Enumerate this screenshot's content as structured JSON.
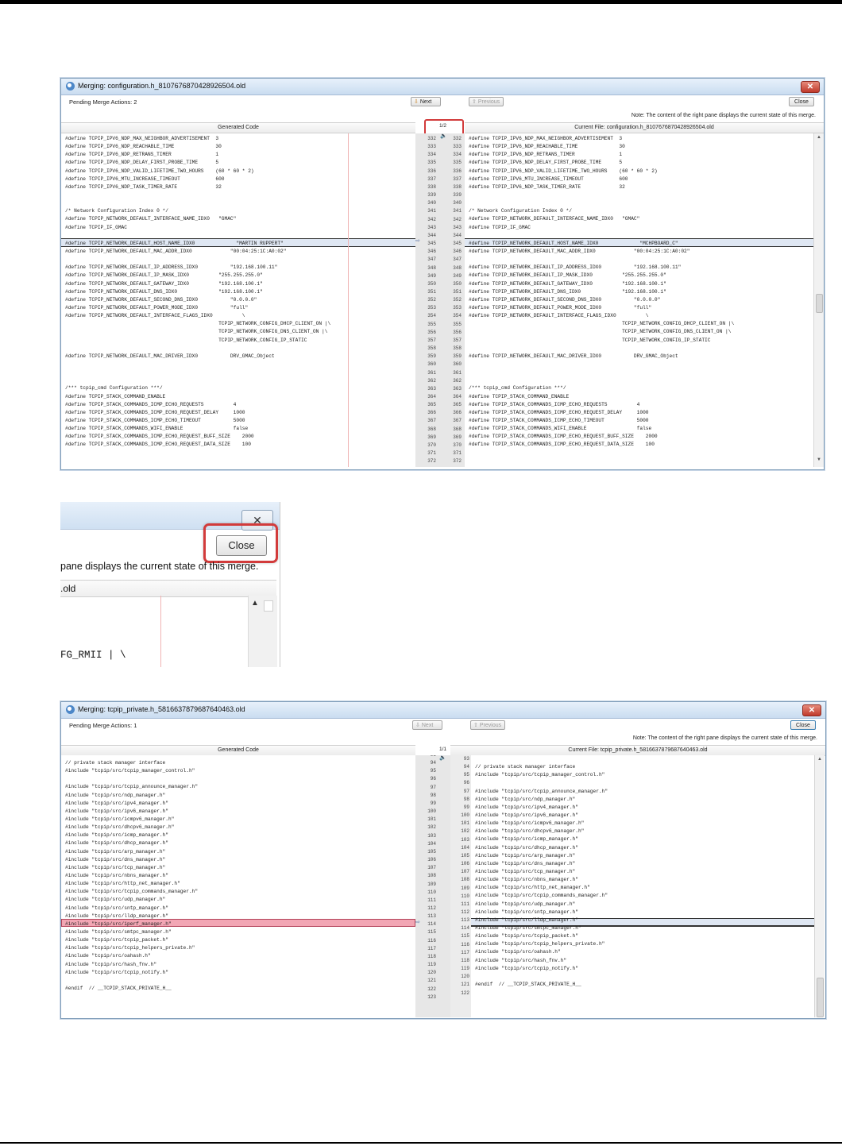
{
  "dialog1": {
    "title": "Merging: configuration.h_8107676870428926504.old",
    "pending_label": "Pending Merge Actions:  2",
    "next_label": "Next",
    "previous_label": "Previous",
    "close_label": "Close",
    "note": "Note:  The content of the right pane displays the current state of this merge.",
    "left_header": "Generated Code",
    "right_header": "Current File: configuration.h_8107676870428926504.old",
    "counter": "1/2",
    "left_lines": [
      "#define TCPIP_IPV6_NDP_MAX_NEIGHBOR_ADVERTISEMENT  3",
      "#define TCPIP_IPV6_NDP_REACHABLE_TIME              30",
      "#define TCPIP_IPV6_NDP_RETRANS_TIMER               1",
      "#define TCPIP_IPV6_NDP_DELAY_FIRST_PROBE_TIME      5",
      "#define TCPIP_IPV6_NDP_VALID_LIFETIME_TWO_HOURS    (60 * 60 * 2)",
      "#define TCPIP_IPV6_MTU_INCREASE_TIMEOUT            600",
      "#define TCPIP_IPV6_NDP_TASK_TIMER_RATE             32",
      "",
      "",
      "/* Network Configuration Index 0 */",
      "#define TCPIP_NETWORK_DEFAULT_INTERFACE_NAME_IDX0   \"GMAC\"",
      "#define TCPIP_IF_GMAC",
      "",
      "#define TCPIP_NETWORK_DEFAULT_HOST_NAME_IDX0              \"MARTIN RUPPERT\"",
      "#define TCPIP_NETWORK_DEFAULT_MAC_ADDR_IDX0             \"00:04:25:1C:A0:02\"",
      "",
      "#define TCPIP_NETWORK_DEFAULT_IP_ADDRESS_IDX0           \"192.168.100.11\"",
      "#define TCPIP_NETWORK_DEFAULT_IP_MASK_IDX0          \"255.255.255.0\"",
      "#define TCPIP_NETWORK_DEFAULT_GATEWAY_IDX0          \"192.168.100.1\"",
      "#define TCPIP_NETWORK_DEFAULT_DNS_IDX0              \"192.168.100.1\"",
      "#define TCPIP_NETWORK_DEFAULT_SECOND_DNS_IDX0           \"0.0.0.0\"",
      "#define TCPIP_NETWORK_DEFAULT_POWER_MODE_IDX0           \"full\"",
      "#define TCPIP_NETWORK_DEFAULT_INTERFACE_FLAGS_IDX0          \\",
      "                                                    TCPIP_NETWORK_CONFIG_DHCP_CLIENT_ON |\\",
      "                                                    TCPIP_NETWORK_CONFIG_DNS_CLIENT_ON |\\",
      "                                                    TCPIP_NETWORK_CONFIG_IP_STATIC",
      "",
      "#define TCPIP_NETWORK_DEFAULT_MAC_DRIVER_IDX0           DRV_GMAC_Object",
      "",
      "",
      "",
      "/*** tcpip_cmd Configuration ***/",
      "#define TCPIP_STACK_COMMAND_ENABLE",
      "#define TCPIP_STACK_COMMANDS_ICMP_ECHO_REQUESTS          4",
      "#define TCPIP_STACK_COMMANDS_ICMP_ECHO_REQUEST_DELAY     1000",
      "#define TCPIP_STACK_COMMANDS_ICMP_ECHO_TIMEOUT           5000",
      "#define TCPIP_STACK_COMMANDS_WIFI_ENABLE                 false",
      "#define TCPIP_STACK_COMMANDS_ICMP_ECHO_REQUEST_BUFF_SIZE    2000",
      "#define TCPIP_STACK_COMMANDS_ICMP_ECHO_REQUEST_DATA_SIZE    100"
    ],
    "right_lines": [
      "#define TCPIP_IPV6_NDP_MAX_NEIGHBOR_ADVERTISEMENT  3",
      "#define TCPIP_IPV6_NDP_REACHABLE_TIME              30",
      "#define TCPIP_IPV6_NDP_RETRANS_TIMER               1",
      "#define TCPIP_IPV6_NDP_DELAY_FIRST_PROBE_TIME      5",
      "#define TCPIP_IPV6_NDP_VALID_LIFETIME_TWO_HOURS    (60 * 60 * 2)",
      "#define TCPIP_IPV6_MTU_INCREASE_TIMEOUT            600",
      "#define TCPIP_IPV6_NDP_TASK_TIMER_RATE             32",
      "",
      "",
      "/* Network Configuration Index 0 */",
      "#define TCPIP_NETWORK_DEFAULT_INTERFACE_NAME_IDX0   \"GMAC\"",
      "#define TCPIP_IF_GMAC",
      "",
      "#define TCPIP_NETWORK_DEFAULT_HOST_NAME_IDX0              \"MCHPBOARD_C\"",
      "#define TCPIP_NETWORK_DEFAULT_MAC_ADDR_IDX0             \"00:04:25:1C:A0:02\"",
      "",
      "#define TCPIP_NETWORK_DEFAULT_IP_ADDRESS_IDX0           \"192.168.100.11\"",
      "#define TCPIP_NETWORK_DEFAULT_IP_MASK_IDX0          \"255.255.255.0\"",
      "#define TCPIP_NETWORK_DEFAULT_GATEWAY_IDX0          \"192.168.100.1\"",
      "#define TCPIP_NETWORK_DEFAULT_DNS_IDX0              \"192.168.100.1\"",
      "#define TCPIP_NETWORK_DEFAULT_SECOND_DNS_IDX0           \"0.0.0.0\"",
      "#define TCPIP_NETWORK_DEFAULT_POWER_MODE_IDX0           \"full\"",
      "#define TCPIP_NETWORK_DEFAULT_INTERFACE_FLAGS_IDX0          \\",
      "                                                    TCPIP_NETWORK_CONFIG_DHCP_CLIENT_ON |\\",
      "                                                    TCPIP_NETWORK_CONFIG_DNS_CLIENT_ON |\\",
      "                                                    TCPIP_NETWORK_CONFIG_IP_STATIC",
      "",
      "#define TCPIP_NETWORK_DEFAULT_MAC_DRIVER_IDX0           DRV_GMAC_Object",
      "",
      "",
      "",
      "/*** tcpip_cmd Configuration ***/",
      "#define TCPIP_STACK_COMMAND_ENABLE",
      "#define TCPIP_STACK_COMMANDS_ICMP_ECHO_REQUESTS          4",
      "#define TCPIP_STACK_COMMANDS_ICMP_ECHO_REQUEST_DELAY     1000",
      "#define TCPIP_STACK_COMMANDS_ICMP_ECHO_TIMEOUT           5000",
      "#define TCPIP_STACK_COMMANDS_WIFI_ENABLE                 false",
      "#define TCPIP_STACK_COMMANDS_ICMP_ECHO_REQUEST_BUFF_SIZE    2000",
      "#define TCPIP_STACK_COMMANDS_ICMP_ECHO_REQUEST_DATA_SIZE    100"
    ],
    "left_numbers": "332\n333\n334\n335\n336\n337\n338\n339\n340\n341\n342\n343\n344\n345\n346\n347\n348\n349\n350\n351\n352\n353\n354\n355\n356\n357\n358\n359\n360\n361\n362\n363\n364\n365\n366\n367\n368\n369\n370\n371\n372",
    "right_numbers": "332\n333\n334\n335\n336\n337\n338\n339\n340\n341\n342\n343\n344\n345\n346\n347\n348\n349\n350\n351\n352\n353\n354\n355\n356\n357\n358\n359\n360\n361\n362\n363\n364\n365\n366\n367\n368\n369\n370\n371\n372"
  },
  "zoom": {
    "close_label": "Close",
    "note": "pane displays the current state of this merge.",
    "header": ".old",
    "code": "FG_RMII | \\"
  },
  "dialog2": {
    "title": "Merging: tcpip_private.h_5816637879687640463.old",
    "pending_label": "Pending Merge Actions:  1",
    "next_label": "Next",
    "previous_label": "Previous",
    "close_label": "Close",
    "note": "Note:  The content of the right pane displays the current state of this merge.",
    "left_header": "Generated Code",
    "right_header": "Current File: tcpip_private.h_5816637879687640463.old",
    "counter": "1/1",
    "left_lines": [
      "// private stack manager interface",
      "#include \"tcpip/src/tcpip_manager_control.h\"",
      "",
      "#include \"tcpip/src/tcpip_announce_manager.h\"",
      "#include \"tcpip/src/ndp_manager.h\"",
      "#include \"tcpip/src/ipv4_manager.h\"",
      "#include \"tcpip/src/ipv6_manager.h\"",
      "#include \"tcpip/src/icmpv6_manager.h\"",
      "#include \"tcpip/src/dhcpv6_manager.h\"",
      "#include \"tcpip/src/icmp_manager.h\"",
      "#include \"tcpip/src/dhcp_manager.h\"",
      "#include \"tcpip/src/arp_manager.h\"",
      "#include \"tcpip/src/dns_manager.h\"",
      "#include \"tcpip/src/tcp_manager.h\"",
      "#include \"tcpip/src/nbns_manager.h\"",
      "#include \"tcpip/src/http_net_manager.h\"",
      "#include \"tcpip/src/tcpip_commands_manager.h\"",
      "#include \"tcpip/src/udp_manager.h\"",
      "#include \"tcpip/src/sntp_manager.h\"",
      "#include \"tcpip/src/lldp_manager.h\"",
      "#include \"tcpip/src/iperf_manager.h\"",
      "#include \"tcpip/src/smtpc_manager.h\"",
      "#include \"tcpip/src/tcpip_packet.h\"",
      "#include \"tcpip/src/tcpip_helpers_private.h\"",
      "#include \"tcpip/src/oahash.h\"",
      "#include \"tcpip/src/hash_fnv.h\"",
      "#include \"tcpip/src/tcpip_notify.h\"",
      "",
      "#endif  // __TCPIP_STACK_PRIVATE_H__"
    ],
    "right_lines": [
      "",
      "// private stack manager interface",
      "#include \"tcpip/src/tcpip_manager_control.h\"",
      "",
      "#include \"tcpip/src/tcpip_announce_manager.h\"",
      "#include \"tcpip/src/ndp_manager.h\"",
      "#include \"tcpip/src/ipv4_manager.h\"",
      "#include \"tcpip/src/ipv6_manager.h\"",
      "#include \"tcpip/src/icmpv6_manager.h\"",
      "#include \"tcpip/src/dhcpv6_manager.h\"",
      "#include \"tcpip/src/icmp_manager.h\"",
      "#include \"tcpip/src/dhcp_manager.h\"",
      "#include \"tcpip/src/arp_manager.h\"",
      "#include \"tcpip/src/dns_manager.h\"",
      "#include \"tcpip/src/tcp_manager.h\"",
      "#include \"tcpip/src/nbns_manager.h\"",
      "#include \"tcpip/src/http_net_manager.h\"",
      "#include \"tcpip/src/tcpip_commands_manager.h\"",
      "#include \"tcpip/src/udp_manager.h\"",
      "#include \"tcpip/src/sntp_manager.h\"",
      "#include \"tcpip/src/lldp_manager.h\"",
      "#include \"tcpip/src/smtpc_manager.h\"",
      "#include \"tcpip/src/tcpip_packet.h\"",
      "#include \"tcpip/src/tcpip_helpers_private.h\"",
      "#include \"tcpip/src/oahash.h\"",
      "#include \"tcpip/src/hash_fnv.h\"",
      "#include \"tcpip/src/tcpip_notify.h\"",
      "",
      "#endif  // __TCPIP_STACK_PRIVATE_H__"
    ],
    "left_numbers": "93\n94\n95\n96\n97\n98\n99\n100\n101\n102\n103\n104\n105\n106\n107\n108\n109\n110\n111\n112\n113\n114\n115\n116\n117\n118\n119\n120\n121\n122\n123",
    "right_numbers": "93\n94\n95\n96\n97\n98\n99\n100\n101\n102\n103\n104\n105\n106\n107\n108\n109\n110\n111\n112\n113\n114\n115\n116\n117\n118\n119\n120\n121\n122"
  }
}
